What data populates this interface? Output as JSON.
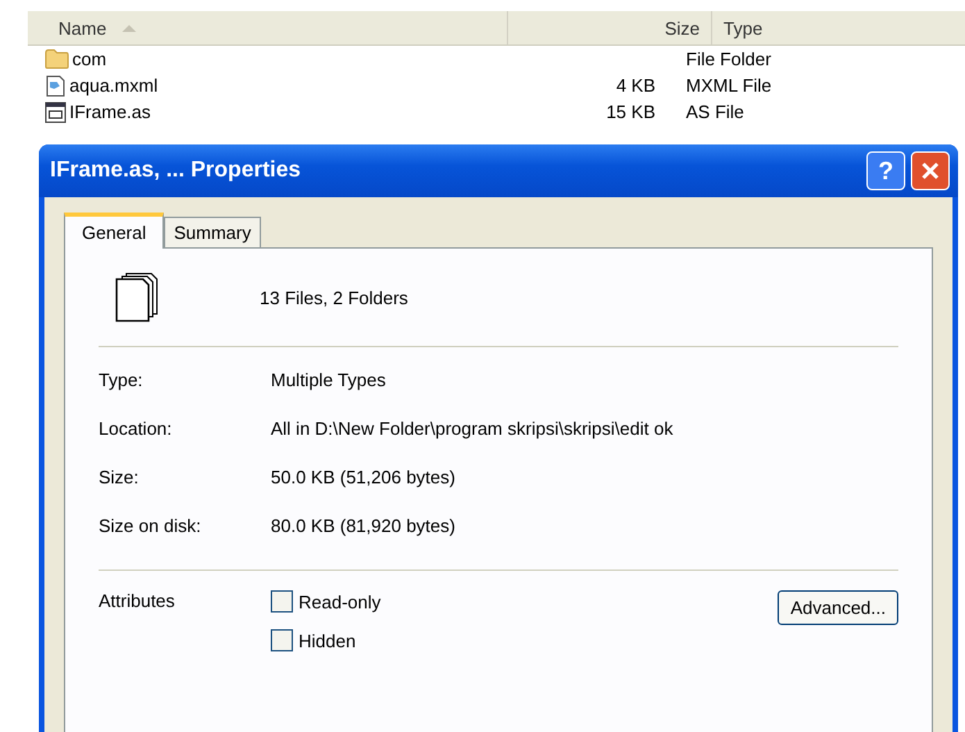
{
  "explorer": {
    "columns": [
      {
        "label": "Name",
        "sorted": true
      },
      {
        "label": "Size",
        "sorted": false
      },
      {
        "label": "Type",
        "sorted": false
      }
    ],
    "rows": [
      {
        "kind": "folder",
        "name": "com",
        "size": "",
        "type": "File Folder"
      },
      {
        "kind": "mxml",
        "name": "aqua.mxml",
        "size": "4 KB",
        "type": "MXML File"
      },
      {
        "kind": "as",
        "name": "IFrame.as",
        "size": "15 KB",
        "type": "AS File"
      }
    ]
  },
  "dialog": {
    "title": "IFrame.as, ... Properties",
    "help": "?",
    "tabs": [
      {
        "label": "General",
        "selected": true
      },
      {
        "label": "Summary",
        "selected": false
      }
    ],
    "summary": "13 Files, 2 Folders",
    "fields": [
      {
        "label": "Type:",
        "value": "Multiple Types"
      },
      {
        "label": "Location:",
        "value": "All in D:\\New Folder\\program skripsi\\skripsi\\edit ok"
      },
      {
        "label": "Size:",
        "value": "50.0 KB (51,206 bytes)"
      },
      {
        "label": "Size on disk:",
        "value": "80.0 KB (81,920 bytes)"
      }
    ],
    "attributes_label": "Attributes",
    "attributes": [
      {
        "label": "Read-only",
        "checked": false
      },
      {
        "label": "Hidden",
        "checked": false
      }
    ],
    "advanced_button": "Advanced..."
  }
}
